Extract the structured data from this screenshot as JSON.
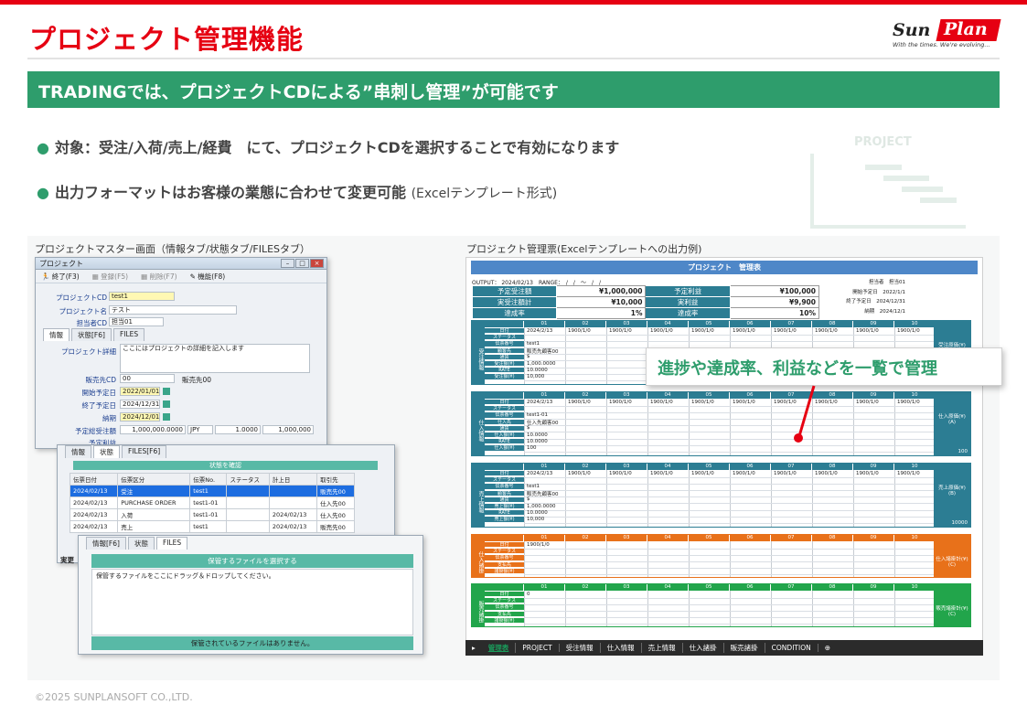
{
  "title": "プロジェクト管理機能",
  "logo": {
    "sun": "Sun",
    "plan": "Plan",
    "tagline": "With the times. We're evolving..."
  },
  "banner": "TRADINGでは、プロジェクトCDによる”串刺し管理”が可能です",
  "bullets": [
    {
      "text": "対象：受注/入荷/売上/経費　にて、プロジェクトCDを選択することで有効になります",
      "sub": ""
    },
    {
      "text": "出力フォーマットはお客様の業態に合わせて変更可能",
      "sub": "(Excelテンプレート形式)"
    }
  ],
  "project_deco_label": "PROJECT",
  "caption_left": "プロジェクトマスター画面（情報タブ/状態タブ/FILESタブ）",
  "caption_right": "プロジェクト管理票(Excelテンプレートへの出力例)",
  "win_master": {
    "title": "プロジェクト",
    "menu": [
      "終了(F3)",
      "登録(F5)",
      "削除(F7)",
      "機能(F8)"
    ],
    "project_cd_label": "プロジェクトCD",
    "project_cd": "test1",
    "project_name_label": "プロジェクト名",
    "project_name": "テスト",
    "owner_label": "担当者CD",
    "owner": "担当01",
    "tabs": [
      "情報",
      "状態[F6]",
      "FILES"
    ],
    "detail_label": "プロジェクト詳細",
    "detail": "ここにはプロジェクトの詳細を記入します",
    "sales_cd_label": "販売先CD",
    "sales_cd": "00",
    "sales_name": "販売先00",
    "start_label": "開始予定日",
    "start": "2022/01/01",
    "end_label": "終了予定日",
    "end": "2024/12/31",
    "due_label": "納期",
    "due": "2024/12/01",
    "plan_order_label": "予定総受注額",
    "plan_order": "1,000,000.0000",
    "currency": "JPY",
    "rate": "1.0000",
    "plan_order_jpy": "1,000,000",
    "plan_profit_label": "予定利益",
    "plan_profit": "100,000.0000",
    "currency2": "JPY",
    "rate2": "1.0000",
    "plan_profit_jpy": "100,000"
  },
  "win_status": {
    "tabs": [
      "情報",
      "状態",
      "FILES[F6]"
    ],
    "header": "状態を確認",
    "columns": [
      "伝票日付",
      "伝票区分",
      "伝票No.",
      "ステータス",
      "計上日",
      "取引先"
    ],
    "rows": [
      [
        "2024/02/13",
        "受注",
        "test1",
        "",
        "",
        "販売先00"
      ],
      [
        "2024/02/13",
        "PURCHASE ORDER",
        "test1-01",
        "",
        "",
        "仕入先00"
      ],
      [
        "2024/02/13",
        "入荷",
        "test1-01",
        "",
        "2024/02/13",
        "仕入先00"
      ],
      [
        "2024/02/13",
        "売上",
        "test1",
        "",
        "2024/02/13",
        "販売先00"
      ]
    ],
    "footer_left": "実更",
    "footer_right": "売"
  },
  "win_files": {
    "tabs": [
      "情報[F6]",
      "状態",
      "FILES"
    ],
    "header": "保管するファイルを選択する",
    "drop": "保管するファイルをここにドラッグ＆ドロップしてください。",
    "footer": "保管されているファイルはありません。"
  },
  "excel": {
    "title": "プロジェクト　管理表",
    "output": "OUTPUT： 2024/02/13　RANGE：　/　/　～　/　/",
    "summary": [
      [
        "予定受注額",
        "¥1,000,000",
        "予定利益",
        "¥100,000"
      ],
      [
        "実受注額計",
        "¥10,000",
        "実利益",
        "¥9,900"
      ],
      [
        "達成率",
        "1%",
        "達成率",
        "10%"
      ]
    ],
    "meta": [
      [
        "担当者",
        "担当01"
      ],
      [
        "開始予定日",
        "2022/1/1"
      ],
      [
        "終了予定日",
        "2024/12/31"
      ],
      [
        "納期",
        "2024/12/1"
      ]
    ],
    "cols": [
      "01",
      "02",
      "03",
      "04",
      "05",
      "06",
      "07",
      "08",
      "09",
      "10"
    ],
    "blocks": [
      {
        "side": "受注情報",
        "color": "#2c7d93",
        "right": "受注原価(¥)",
        "right2": "",
        "total": "",
        "rows": [
          "日付",
          "ステータス",
          "伝票番号",
          "顧客先",
          "通貨",
          "受注額(¥)",
          "RATE",
          "受注額(¥)"
        ],
        "vals": [
          "2024/2/13",
          "",
          "test1",
          "販売先顧客00",
          "$",
          "1,000.0000",
          "10.0000",
          "10,000"
        ]
      },
      {
        "side": "仕入情報",
        "color": "#2c7d93",
        "right": "仕入原価(¥)",
        "right2": "(A)",
        "total": "100",
        "rows": [
          "日付",
          "ステータス",
          "伝票番号",
          "仕入先",
          "通貨",
          "仕入額(¥)",
          "RATE",
          "仕入額(¥)"
        ],
        "vals": [
          "2024/2/13",
          "",
          "test1-01",
          "仕入先顧客00",
          "$",
          "10.0000",
          "10.0000",
          "100"
        ]
      },
      {
        "side": "売上情報",
        "color": "#2c7d93",
        "right": "売上原価(¥)",
        "right2": "(B)",
        "total": "10000",
        "rows": [
          "日付",
          "ステータス",
          "伝票番号",
          "顧客先",
          "通貨",
          "売上額(¥)",
          "RATE",
          "売上額(¥)"
        ],
        "vals": [
          "2024/2/13",
          "",
          "test1",
          "販売先顧客00",
          "$",
          "1,000.0000",
          "10.0000",
          "10,000"
        ]
      },
      {
        "side": "仕入諸掛",
        "color": "#e8711a",
        "right": "仕入諸掛計(¥)",
        "right2": "(C)",
        "total": "",
        "rows": [
          "日付",
          "ステータス",
          "伝票番号",
          "支払先",
          "諸掛額(¥)"
        ],
        "vals": [
          "1900/1/0",
          "",
          "",
          "",
          ""
        ]
      },
      {
        "side": "販売諸掛",
        "color": "#22a54b",
        "right": "販売諸掛計(¥)",
        "right2": "(C)",
        "total": "",
        "rows": [
          "日付",
          "ステータス",
          "伝票番号",
          "支払先",
          "諸掛額(¥)"
        ],
        "vals": [
          "0",
          "",
          "",
          "",
          ""
        ]
      }
    ],
    "default_cell": "1900/1/0",
    "sheets": [
      "管理表",
      "PROJECT",
      "受注情報",
      "仕入情報",
      "売上情報",
      "仕入諸掛",
      "販売諸掛",
      "CONDITION"
    ]
  },
  "callout": "進捗や達成率、利益などを一覧で管理",
  "copyright": "©2025 SUNPLANSOFT CO.,LTD."
}
